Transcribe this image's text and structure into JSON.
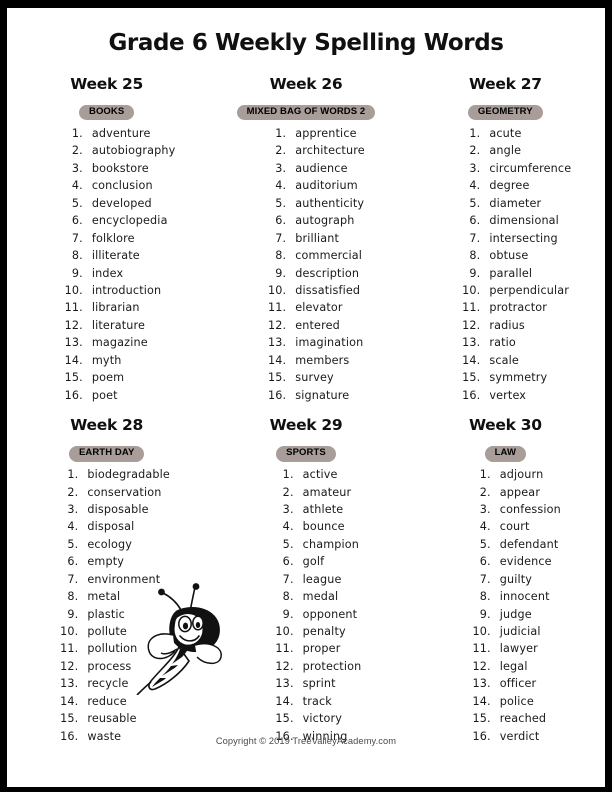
{
  "document": {
    "title": "Grade 6 Weekly Spelling Words",
    "footer": "Copyright © 2019 TreeValleyAcademy.com",
    "border_color": "#000000",
    "badge_color": "#a89d99",
    "text_color": "#1a1a1a"
  },
  "decorations": {
    "bee_illustration": "bee-mascot"
  },
  "weeks": [
    {
      "title": "Week 25",
      "category": "BOOKS",
      "words": [
        "adventure",
        "autobiography",
        "bookstore",
        "conclusion",
        "developed",
        "encyclopedia",
        "folklore",
        "illiterate",
        "index",
        "introduction",
        "librarian",
        "literature",
        "magazine",
        "myth",
        "poem",
        "poet"
      ]
    },
    {
      "title": "Week 26",
      "category": "MIXED BAG OF WORDS 2",
      "words": [
        "apprentice",
        "architecture",
        "audience",
        "auditorium",
        "authenticity",
        "autograph",
        "brilliant",
        "commercial",
        "description",
        "dissatisfied",
        "elevator",
        "entered",
        "imagination",
        "members",
        "survey",
        "signature"
      ]
    },
    {
      "title": "Week 27",
      "category": "GEOMETRY",
      "words": [
        "acute",
        "angle",
        "circumference",
        "degree",
        "diameter",
        "dimensional",
        "intersecting",
        "obtuse",
        "parallel",
        "perpendicular",
        "protractor",
        "radius",
        "ratio",
        "scale",
        "symmetry",
        "vertex"
      ]
    },
    {
      "title": "Week 28",
      "category": "EARTH DAY",
      "words": [
        "biodegradable",
        "conservation",
        "disposable",
        "disposal",
        "ecology",
        "empty",
        "environment",
        "metal",
        "plastic",
        "pollute",
        "pollution",
        "process",
        "recycle",
        "reduce",
        "reusable",
        "waste"
      ]
    },
    {
      "title": "Week 29",
      "category": "SPORTS",
      "words": [
        "active",
        "amateur",
        "athlete",
        "bounce",
        "champion",
        "golf",
        "league",
        "medal",
        "opponent",
        "penalty",
        "proper",
        "protection",
        "sprint",
        "track",
        "victory",
        "winning"
      ]
    },
    {
      "title": "Week 30",
      "category": "LAW",
      "words": [
        "adjourn",
        "appear",
        "confession",
        "court",
        "defendant",
        "evidence",
        "guilty",
        "innocent",
        "judge",
        "judicial",
        "lawyer",
        "legal",
        "officer",
        "police",
        "reached",
        "verdict"
      ]
    }
  ]
}
